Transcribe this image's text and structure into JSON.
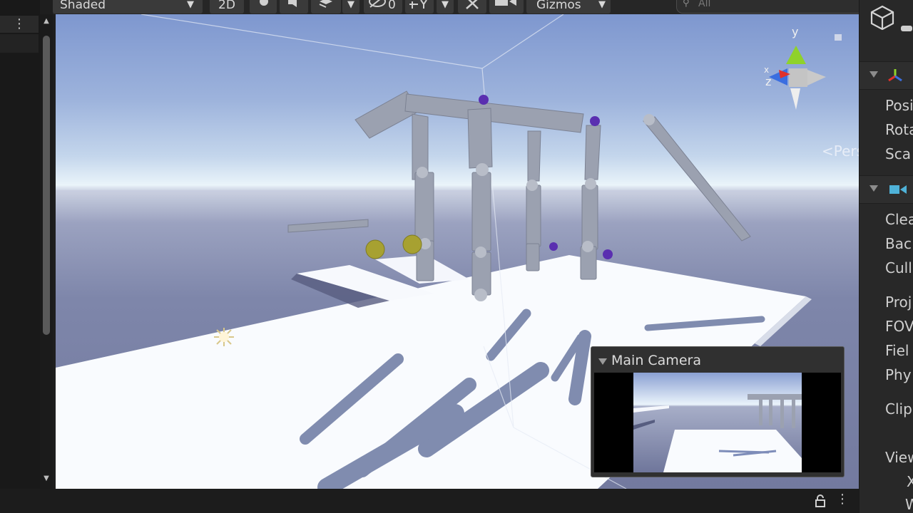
{
  "toolbar": {
    "shading_mode": "Shaded",
    "mode_2d": "2D",
    "hidden_count": "0",
    "gizmos_label": "Gizmos",
    "search_placeholder": "All"
  },
  "scene": {
    "projection_label": "Persp",
    "axis_x": "x",
    "axis_y": "y",
    "axis_z": "z"
  },
  "camera_preview": {
    "title": "Main Camera"
  },
  "inspector": {
    "transform_rows": [
      "Posi",
      "Rota",
      "Sca"
    ],
    "camera_rows": [
      "Clea",
      "Bac",
      "Cull",
      "Proj",
      "FOV",
      "Fiel",
      "Phy",
      "Clip",
      "View",
      "X",
      "W"
    ]
  },
  "colors": {
    "accent_x": "#e0312b",
    "accent_y": "#8fd22b",
    "accent_z": "#3b6ee0",
    "camera_icon": "#4fb2d8"
  },
  "icons": {
    "lock": "lock-icon",
    "kebab": "kebab-menu-icon"
  }
}
